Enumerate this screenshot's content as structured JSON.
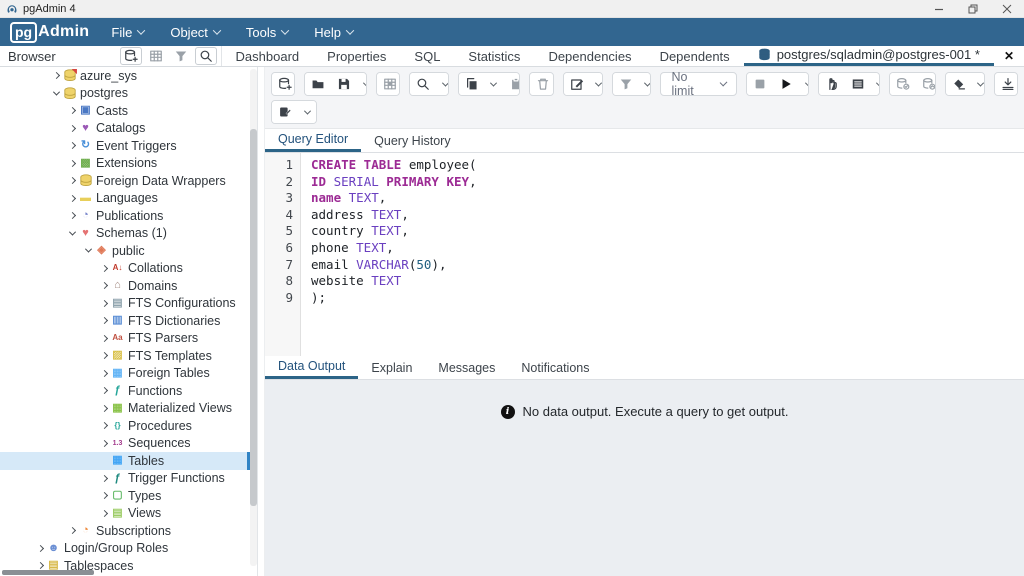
{
  "theme": {
    "menubar": "#326690",
    "accent_underline": "#2c6487",
    "tree_selection": "#d6e9f8",
    "selection_bar": "#3184c5",
    "toolbar_bg": "#f4f5f7",
    "results_bg": "#ebeef2"
  },
  "window": {
    "title": "pgAdmin 4",
    "controls": [
      {
        "name": "minimize",
        "glyph": "minus"
      },
      {
        "name": "restore",
        "glyph": "overlap-squares"
      },
      {
        "name": "close",
        "glyph": "x"
      }
    ]
  },
  "menubar": {
    "logo_pg": "pg",
    "logo_admin": "Admin",
    "items": [
      {
        "label": "File"
      },
      {
        "label": "Object"
      },
      {
        "label": "Tools"
      },
      {
        "label": "Help"
      }
    ]
  },
  "browser_panel": {
    "title": "Browser",
    "toolbar": [
      {
        "name": "add-server",
        "icon": "db-new",
        "boxed": true,
        "disabled": false
      },
      {
        "name": "dependencies-grid",
        "icon": "grid",
        "boxed": false,
        "disabled": true
      },
      {
        "name": "filter",
        "icon": "filter",
        "boxed": false,
        "disabled": true
      },
      {
        "name": "search-objects",
        "icon": "search",
        "boxed": true,
        "disabled": false
      }
    ],
    "tree": [
      {
        "label": "azure_sys",
        "ind": 50,
        "chev": "right",
        "icon": "db-off"
      },
      {
        "label": "postgres",
        "ind": 50,
        "chev": "down",
        "icon": "db"
      },
      {
        "label": "Casts",
        "ind": 66,
        "chev": "right",
        "icon": "casts"
      },
      {
        "label": "Catalogs",
        "ind": 66,
        "chev": "right",
        "icon": "catalogs"
      },
      {
        "label": "Event Triggers",
        "ind": 66,
        "chev": "right",
        "icon": "event-triggers"
      },
      {
        "label": "Extensions",
        "ind": 66,
        "chev": "right",
        "icon": "extensions"
      },
      {
        "label": "Foreign Data Wrappers",
        "ind": 66,
        "chev": "right",
        "icon": "fdw"
      },
      {
        "label": "Languages",
        "ind": 66,
        "chev": "right",
        "icon": "languages"
      },
      {
        "label": "Publications",
        "ind": 66,
        "chev": "right",
        "icon": "publications"
      },
      {
        "label": "Schemas (1)",
        "ind": 66,
        "chev": "down",
        "icon": "schemas"
      },
      {
        "label": "public",
        "ind": 82,
        "chev": "down",
        "icon": "schema-public"
      },
      {
        "label": "Collations",
        "ind": 98,
        "chev": "right",
        "icon": "collations"
      },
      {
        "label": "Domains",
        "ind": 98,
        "chev": "right",
        "icon": "domains"
      },
      {
        "label": "FTS Configurations",
        "ind": 98,
        "chev": "right",
        "icon": "fts-config"
      },
      {
        "label": "FTS Dictionaries",
        "ind": 98,
        "chev": "right",
        "icon": "fts-dict"
      },
      {
        "label": "FTS Parsers",
        "ind": 98,
        "chev": "right",
        "icon": "fts-parsers"
      },
      {
        "label": "FTS Templates",
        "ind": 98,
        "chev": "right",
        "icon": "fts-templates"
      },
      {
        "label": "Foreign Tables",
        "ind": 98,
        "chev": "right",
        "icon": "foreign-tables"
      },
      {
        "label": "Functions",
        "ind": 98,
        "chev": "right",
        "icon": "functions"
      },
      {
        "label": "Materialized Views",
        "ind": 98,
        "chev": "right",
        "icon": "mat-views"
      },
      {
        "label": "Procedures",
        "ind": 98,
        "chev": "right",
        "icon": "procedures"
      },
      {
        "label": "Sequences",
        "ind": 98,
        "chev": "right",
        "icon": "sequences"
      },
      {
        "label": "Tables",
        "ind": 98,
        "chev": "none",
        "icon": "tables",
        "selected": true
      },
      {
        "label": "Trigger Functions",
        "ind": 98,
        "chev": "right",
        "icon": "trigger-functions"
      },
      {
        "label": "Types",
        "ind": 98,
        "chev": "right",
        "icon": "types"
      },
      {
        "label": "Views",
        "ind": 98,
        "chev": "right",
        "icon": "views"
      },
      {
        "label": "Subscriptions",
        "ind": 66,
        "chev": "right",
        "icon": "subscriptions"
      },
      {
        "label": "Login/Group Roles",
        "ind": 34,
        "chev": "right",
        "icon": "roles"
      },
      {
        "label": "Tablespaces",
        "ind": 34,
        "chev": "right",
        "icon": "tablespaces"
      }
    ]
  },
  "main_tabs": {
    "static": [
      {
        "label": "Dashboard"
      },
      {
        "label": "Properties"
      },
      {
        "label": "SQL"
      },
      {
        "label": "Statistics"
      },
      {
        "label": "Dependencies"
      },
      {
        "label": "Dependents"
      }
    ],
    "query_tab": {
      "label": "postgres/sqladmin@postgres-001 *",
      "icon": "db-small",
      "active": true
    },
    "close_label": "✕"
  },
  "query_toolbar": {
    "row1_groups": [
      {
        "items": [
          {
            "name": "new-query-tool",
            "icon": "db-new"
          }
        ]
      },
      {
        "items": [
          {
            "name": "open-file",
            "icon": "folder"
          },
          {
            "name": "save-file",
            "icon": "save"
          },
          {
            "name": "save-dropdown",
            "dd": true
          }
        ]
      },
      {
        "items": [
          {
            "name": "save-data-changes",
            "icon": "grid-save",
            "disabled": true
          }
        ]
      },
      {
        "items": [
          {
            "name": "find",
            "icon": "search"
          },
          {
            "name": "find-dropdown",
            "dd": true
          }
        ]
      },
      {
        "items": [
          {
            "name": "copy",
            "icon": "copy"
          },
          {
            "name": "copy-dropdown",
            "dd": true
          },
          {
            "name": "paste",
            "icon": "paste",
            "disabled": true
          }
        ]
      },
      {
        "items": [
          {
            "name": "delete",
            "icon": "trash",
            "disabled": true
          }
        ]
      },
      {
        "items": [
          {
            "name": "edit",
            "icon": "edit"
          },
          {
            "name": "edit-dropdown",
            "dd": true
          }
        ]
      },
      {
        "items": [
          {
            "name": "filter",
            "icon": "filter",
            "disabled": true
          },
          {
            "name": "filter-dropdown",
            "dd": true
          }
        ]
      },
      {
        "limit": true
      },
      {
        "items": [
          {
            "name": "cancel-query",
            "icon": "stop",
            "disabled": true
          },
          {
            "name": "execute-query",
            "icon": "play"
          },
          {
            "name": "execute-dropdown",
            "dd": true
          }
        ]
      },
      {
        "items": [
          {
            "name": "explain",
            "icon": "hand"
          },
          {
            "name": "explain-analyze",
            "icon": "list"
          },
          {
            "name": "explain-dropdown",
            "dd": true
          }
        ]
      },
      {
        "items": [
          {
            "name": "commit",
            "icon": "db-check",
            "disabled": true
          },
          {
            "name": "rollback",
            "icon": "db-undo",
            "disabled": true
          }
        ]
      },
      {
        "items": [
          {
            "name": "clear",
            "icon": "eraser"
          },
          {
            "name": "clear-dropdown",
            "dd": true
          }
        ]
      },
      {
        "items": [
          {
            "name": "download-csv",
            "icon": "download"
          }
        ]
      }
    ],
    "limit_value": "No limit",
    "row2_groups": [
      {
        "items": [
          {
            "name": "macros",
            "icon": "macro"
          },
          {
            "name": "macros-dropdown",
            "dd": true
          }
        ]
      }
    ]
  },
  "editor_tabs": [
    {
      "label": "Query Editor",
      "active": true
    },
    {
      "label": "Query History",
      "active": false
    }
  ],
  "sql_editor": {
    "lines": [
      [
        [
          "kw",
          "CREATE TABLE"
        ],
        [
          "pl",
          " employee("
        ]
      ],
      [
        [
          "kw",
          "ID"
        ],
        [
          "pl",
          " "
        ],
        [
          "ty",
          "SERIAL"
        ],
        [
          "pl",
          " "
        ],
        [
          "kw",
          "PRIMARY KEY"
        ],
        [
          "pl",
          ","
        ]
      ],
      [
        [
          "kw",
          "name"
        ],
        [
          "pl",
          " "
        ],
        [
          "ty",
          "TEXT"
        ],
        [
          "pl",
          ","
        ]
      ],
      [
        [
          "pl",
          "address "
        ],
        [
          "ty",
          "TEXT"
        ],
        [
          "pl",
          ","
        ]
      ],
      [
        [
          "pl",
          "country "
        ],
        [
          "ty",
          "TEXT"
        ],
        [
          "pl",
          ","
        ]
      ],
      [
        [
          "pl",
          "phone "
        ],
        [
          "ty",
          "TEXT"
        ],
        [
          "pl",
          ","
        ]
      ],
      [
        [
          "pl",
          "email "
        ],
        [
          "ty",
          "VARCHAR"
        ],
        [
          "pl",
          "("
        ],
        [
          "num",
          "50"
        ],
        [
          "pl",
          "),"
        ]
      ],
      [
        [
          "pl",
          "website "
        ],
        [
          "ty",
          "TEXT"
        ]
      ],
      [
        [
          "pl",
          ");"
        ]
      ]
    ]
  },
  "result_tabs": [
    {
      "label": "Data Output",
      "active": true
    },
    {
      "label": "Explain",
      "active": false
    },
    {
      "label": "Messages",
      "active": false
    },
    {
      "label": "Notifications",
      "active": false
    }
  ],
  "results": {
    "empty_message": "No data output. Execute a query to get output."
  }
}
